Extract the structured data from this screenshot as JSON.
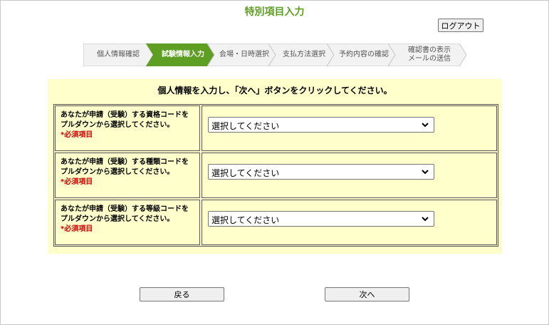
{
  "page": {
    "title": "特別項目入力",
    "logout_label": "ログアウト"
  },
  "steps": [
    {
      "label": "個人情報確認",
      "active": false
    },
    {
      "label": "試験情報入力",
      "active": true
    },
    {
      "label": "会場・日時選択",
      "active": false
    },
    {
      "label": "支払方法選択",
      "active": false
    },
    {
      "label": "予約内容の確認",
      "active": false
    },
    {
      "label_line1": "確認書の表示",
      "label_line2": "メールの送信",
      "active": false
    }
  ],
  "form": {
    "instruction": "個人情報を入力し、「次へ」ボタンをクリックしてください。",
    "required_label": "*必須項目",
    "rows": [
      {
        "line1": "あなたが申請（受験）する資格コードを",
        "line2": "プルダウンから選択してください。",
        "selected": "選択してください"
      },
      {
        "line1": "あなたが申請（受験）する種類コードを",
        "line2": "プルダウンから選択してください。",
        "selected": "選択してください"
      },
      {
        "line1": "あなたが申請（受験）する等級コードを",
        "line2": "プルダウンから選択してください。",
        "selected": "選択してください"
      }
    ]
  },
  "actions": {
    "back_label": "戻る",
    "next_label": "次へ"
  },
  "colors": {
    "title_green": "#5e9e23",
    "active_step": "#5e9e23",
    "step_bg": "#f2f2f2",
    "panel_bg": "#ffffcc",
    "required_red": "#cc0000"
  }
}
